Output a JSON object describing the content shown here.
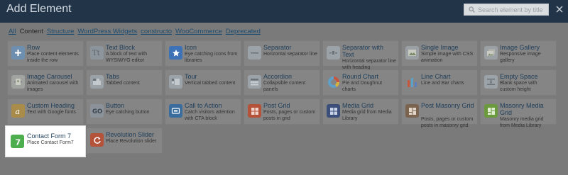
{
  "header": {
    "title": "Add Element",
    "search_placeholder": "Search element by title"
  },
  "tabs": [
    {
      "label": "All",
      "active": false
    },
    {
      "label": "Content",
      "active": true
    },
    {
      "label": "Structure",
      "active": false
    },
    {
      "label": "WordPress Widgets",
      "active": false
    },
    {
      "label": "constructo",
      "active": false
    },
    {
      "label": "WooCommerce",
      "active": false
    },
    {
      "label": "Deprecated",
      "active": false
    }
  ],
  "elements": [
    {
      "name": "Row",
      "desc": "Place content elements inside the row",
      "icon": "row-icon",
      "color": "#6f8fb0"
    },
    {
      "name": "Text Block",
      "desc": "A block of text with WYSIWYG editor",
      "icon": "text-block-icon",
      "color": "#8d959c"
    },
    {
      "name": "Icon",
      "desc": "Eye catching icons from libraries",
      "icon": "star-icon",
      "color": "#3d72b6"
    },
    {
      "name": "Separator",
      "desc": "Horizontal separator line",
      "icon": "separator-icon",
      "color": "#9ba2a8"
    },
    {
      "name": "Separator with Text",
      "desc": "Horizontal separator line with heading",
      "icon": "separator-text-icon",
      "color": "#9ba2a8"
    },
    {
      "name": "Single Image",
      "desc": "Simple image with CSS animation",
      "icon": "image-icon",
      "color": "#9aa0a3"
    },
    {
      "name": "Image Gallery",
      "desc": "Responsive image gallery",
      "icon": "gallery-icon",
      "color": "#9aa0a3"
    },
    {
      "name": "Image Carousel",
      "desc": "Animated carousel with images",
      "icon": "carousel-icon",
      "color": "#a0a3a0"
    },
    {
      "name": "Tabs",
      "desc": "Tabbed content",
      "icon": "tabs-icon",
      "color": "#9ba2a8"
    },
    {
      "name": "Tour",
      "desc": "Vertical tabbed content",
      "icon": "tour-icon",
      "color": "#9ba2a8"
    },
    {
      "name": "Accordion",
      "desc": "Collapsible content panels",
      "icon": "accordion-icon",
      "color": "#9ba2a8"
    },
    {
      "name": "Round Chart",
      "desc": "Pie and Doughnut charts",
      "icon": "round-chart-icon",
      "color": "#9a9a9a"
    },
    {
      "name": "Line Chart",
      "desc": "Line and Bar charts",
      "icon": "line-chart-icon",
      "color": "#9a9a9a"
    },
    {
      "name": "Empty Space",
      "desc": "Blank space with custom height",
      "icon": "empty-space-icon",
      "color": "#9ba2a8"
    },
    {
      "name": "Custom Heading",
      "desc": "Text with Google fonts",
      "icon": "heading-icon",
      "color": "#a98b4a"
    },
    {
      "name": "Button",
      "desc": "Eye catching button",
      "icon": "button-icon",
      "color": "#8b929a"
    },
    {
      "name": "Call to Action",
      "desc": "Catch visitors attention with CTA block",
      "icon": "cta-icon",
      "color": "#3a6d9e"
    },
    {
      "name": "Post Grid",
      "desc": "Posts, pages or custom posts in grid",
      "icon": "post-grid-icon",
      "color": "#b5523a"
    },
    {
      "name": "Media Grid",
      "desc": "Media grid from Media Library",
      "icon": "media-grid-icon",
      "color": "#3b4f7a"
    },
    {
      "name": "Post Masonry Grid",
      "desc": "Posts, pages or custom posts in masonry grid",
      "icon": "masonry-grid-icon",
      "color": "#7a6450"
    },
    {
      "name": "Masonry Media Grid",
      "desc": "Masonry media grid from Media Library",
      "icon": "masonry-media-icon",
      "color": "#6b9a3e"
    },
    {
      "name": "Contact Form 7",
      "desc": "Place Contact Form7",
      "icon": "contact-form-7-icon",
      "color": "#4cae4c"
    },
    {
      "name": "Revolution Slider",
      "desc": "Place Revolution slider",
      "icon": "revolution-slider-icon",
      "color": "#b5523a"
    }
  ]
}
